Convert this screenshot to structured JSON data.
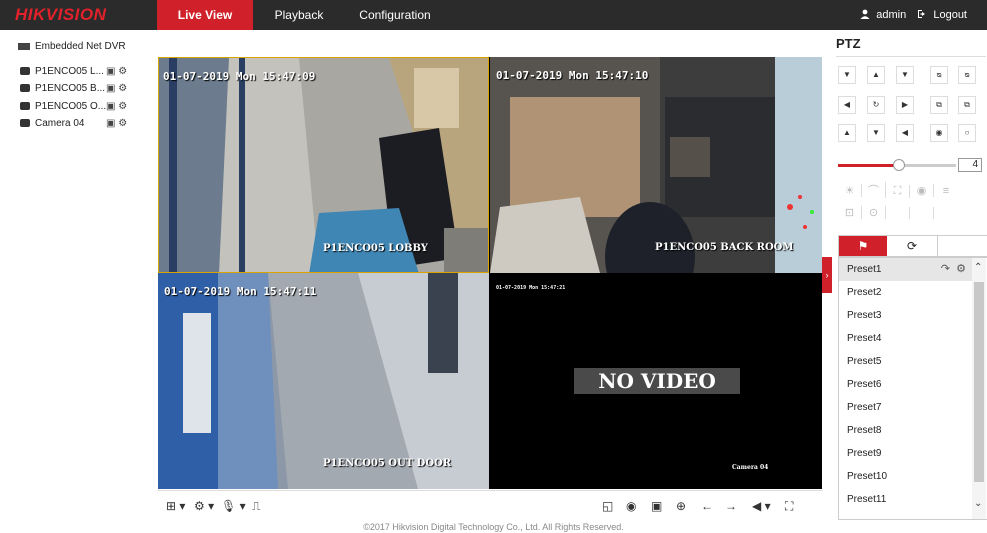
{
  "app": {
    "logo": "HIKVISION"
  },
  "nav": {
    "tabs": [
      {
        "label": "Live View",
        "active": true
      },
      {
        "label": "Playback",
        "active": false
      },
      {
        "label": "Configuration",
        "active": false
      }
    ],
    "user": "admin",
    "logout": "Logout"
  },
  "tree": {
    "root": "Embedded Net DVR",
    "cameras": [
      {
        "label": "P1ENCO05 L..."
      },
      {
        "label": "P1ENCO05 B..."
      },
      {
        "label": "P1ENCO05 O..."
      },
      {
        "label": "Camera 04"
      }
    ]
  },
  "video": {
    "panes": [
      {
        "time": "01-07-2019 Mon 15:47:09",
        "name": "P1ENCO05 LOBBY"
      },
      {
        "time": "01-07-2019 Mon 15:47:10",
        "name": "P1ENCO05 BACK ROOM"
      },
      {
        "time": "01-07-2019 Mon 15:47:11",
        "name": "P1ENCO05 OUT DOOR"
      },
      {
        "time": "01-07-2019 Mon 15:47:21",
        "name": "Camera 04",
        "novideo": "NO VIDEO"
      }
    ]
  },
  "ptz": {
    "title": "PTZ",
    "speed": "4",
    "speed_fraction": 0.52,
    "presets": [
      "Preset1",
      "Preset2",
      "Preset3",
      "Preset4",
      "Preset5",
      "Preset6",
      "Preset7",
      "Preset8",
      "Preset9",
      "Preset10",
      "Preset11"
    ]
  },
  "footer": "©2017 Hikvision Digital Technology Co., Ltd. All Rights Reserved.",
  "colors": {
    "brand": "#d0202a",
    "topbar": "#2b2b2b"
  }
}
